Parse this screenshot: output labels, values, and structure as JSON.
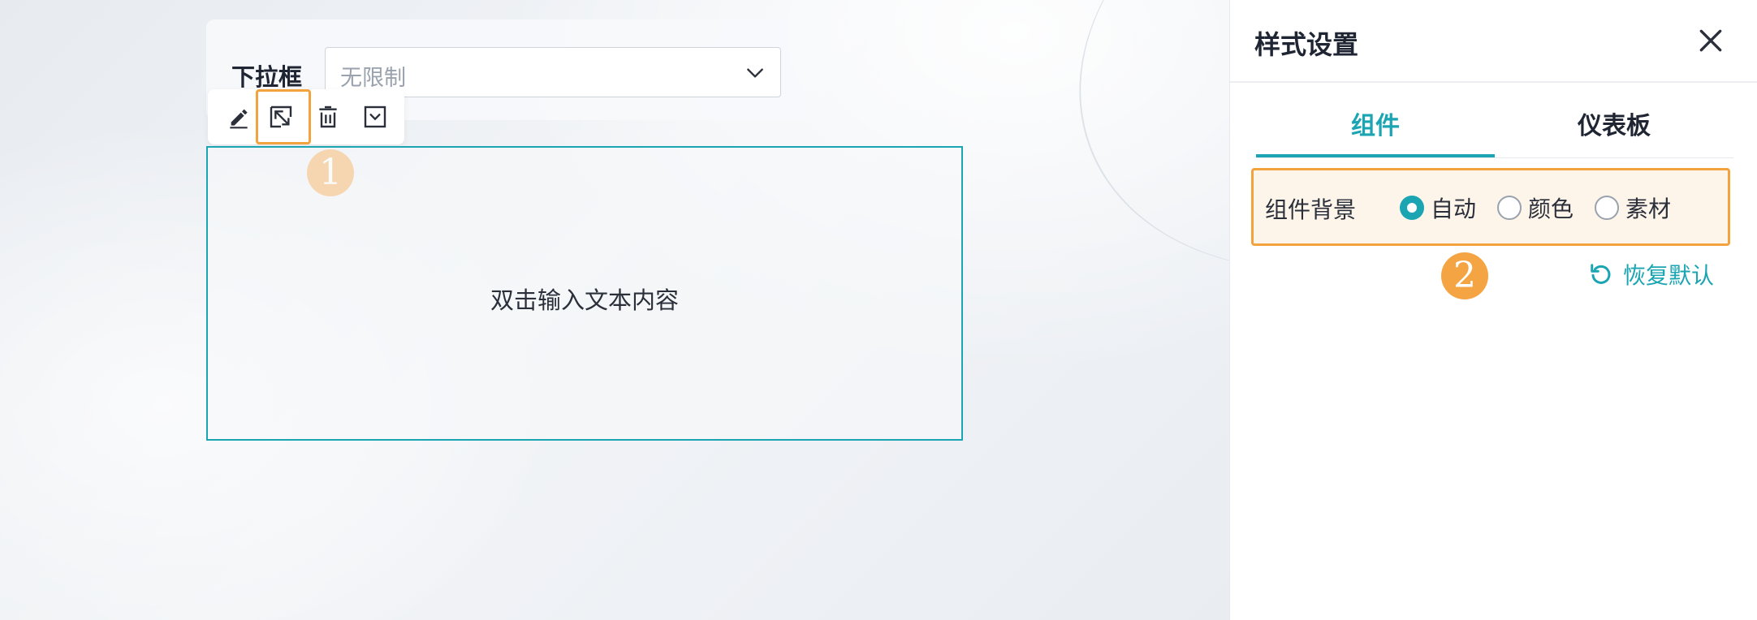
{
  "canvas": {
    "filter": {
      "label": "下拉框",
      "placeholder": "无限制"
    },
    "toolbar": {
      "icons": [
        "edit-icon",
        "style-icon",
        "delete-icon",
        "dropdown-check-icon"
      ]
    },
    "text_box": {
      "placeholder": "双击输入文本内容"
    },
    "markers": [
      "1",
      "2"
    ]
  },
  "panel": {
    "title": "样式设置",
    "close_icon": "close-icon",
    "tabs": [
      {
        "label": "组件",
        "active": true
      },
      {
        "label": "仪表板",
        "active": false
      }
    ],
    "background": {
      "label": "组件背景",
      "options": [
        {
          "label": "自动",
          "checked": true
        },
        {
          "label": "颜色",
          "checked": false
        },
        {
          "label": "素材",
          "checked": false
        }
      ]
    },
    "reset_label": "恢复默认"
  },
  "colors": {
    "accent": "#1ba5b3",
    "highlight": "#f3a33e",
    "marker": "#f5a443",
    "text": "#1f2532"
  }
}
